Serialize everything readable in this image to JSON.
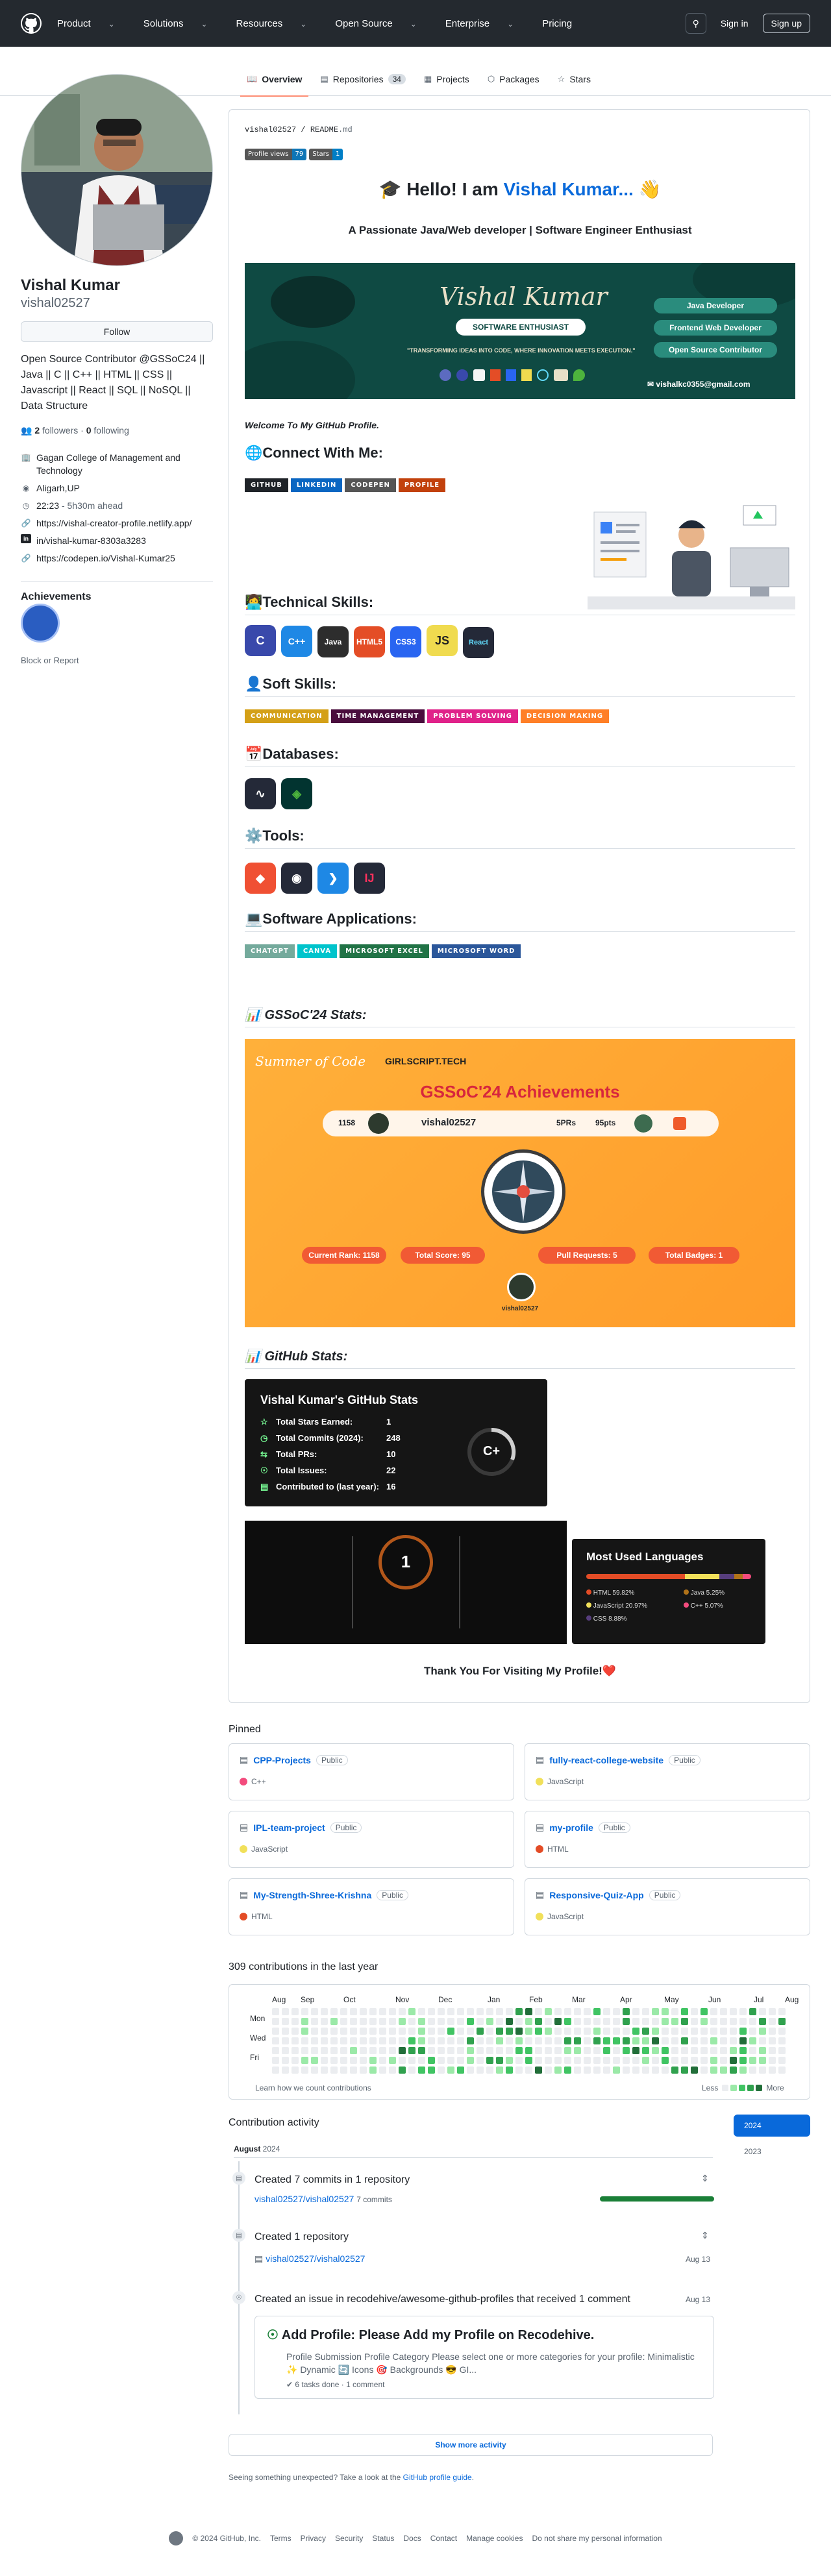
{
  "header": {
    "nav": [
      "Product",
      "Solutions",
      "Resources",
      "Open Source",
      "Enterprise",
      "Pricing"
    ],
    "signin": "Sign in",
    "signup": "Sign up"
  },
  "tabs": [
    {
      "label": "Overview",
      "icon": "book-icon"
    },
    {
      "label": "Repositories",
      "count": "34",
      "icon": "repo-icon"
    },
    {
      "label": "Projects",
      "icon": "table-icon"
    },
    {
      "label": "Packages",
      "icon": "package-icon"
    },
    {
      "label": "Stars",
      "icon": "star-icon"
    }
  ],
  "profile": {
    "name": "Vishal Kumar",
    "username": "vishal02527",
    "follow": "Follow",
    "bio": "Open Source Contributor @GSSoC24 || Java || C || C++ || HTML || CSS || Javascript || React || SQL || NoSQL || Data Structure",
    "followers": "2",
    "followers_label": "followers",
    "following": "0",
    "following_label": "following",
    "org": "Gagan College of Management and Technology",
    "location": "Aligarh,UP",
    "time": "22:23",
    "time_note": "- 5h30m ahead",
    "site": "https://vishal-creator-profile.netlify.app/",
    "linkedin": "in/vishal-kumar-8303a3283",
    "codepen": "https://codepen.io/Vishal-Kumar25",
    "achievements": "Achievements",
    "report": "Block or Report"
  },
  "readme": {
    "path_user": "vishal02527",
    "path_sep": " / ",
    "path_file": "README",
    "path_ext": ".md",
    "views_label": "Profile views",
    "views_value": "79",
    "stars_label": "Stars",
    "stars_value": "1",
    "hello": "Hello! I am ",
    "hello_name": "Vishal Kumar...",
    "subtitle": "A Passionate Java/Web developer | Software Engineer Enthusiast",
    "banner": {
      "name": "Vishal Kumar",
      "role": "SOFTWARE ENTHUSIAST",
      "tagline": "\"TRANSFORMING IDEAS INTO CODE, WHERE INNOVATION MEETS EXECUTION.\"",
      "pill1": "Java Developer",
      "pill2": "Frontend Web Developer",
      "pill3": "Open Source Contributor",
      "email": "vishalkc0355@gmail.com"
    },
    "welcome": "Welcome To My GitHub Profile.",
    "connect": "Connect With Me:",
    "connect_tags": [
      "GITHUB",
      "LINKEDIN",
      "CODEPEN",
      "PROFILE"
    ],
    "tech": "Technical Skills:",
    "tech_icons": [
      "C",
      "C++",
      "Java",
      "HTML5",
      "CSS3",
      "JS",
      "React"
    ],
    "soft": "Soft Skills:",
    "soft_tags": [
      "COMMUNICATION",
      "TIME MANAGEMENT",
      "PROBLEM SOLVING",
      "DECISION MAKING"
    ],
    "db": "Databases:",
    "tools": "Tools:",
    "apps": "Software Applications:",
    "app_tags": [
      "CHATGPT",
      "CANVA",
      "MICROSOFT EXCEL",
      "MICROSOFT WORD"
    ],
    "gssoc_h": "GSSoC'24 Stats:",
    "gssoc": {
      "brand1": "Summer of Code",
      "brand2": "GIRLSCRIPT.TECH",
      "title": "GSSoC'24 Achievements",
      "rank": "1158",
      "user": "vishal02527",
      "prs": "5PRs",
      "pts": "95pts",
      "s1": "Current Rank: 1158",
      "s2": "Total Score: 95",
      "s3": "Pull Requests: 5",
      "s4": "Total Badges: 1",
      "footer": "vishal02527"
    },
    "ghstats_h": "GitHub Stats:",
    "ghstats": {
      "title": "Vishal Kumar's GitHub Stats",
      "rows": [
        {
          "label": "Total Stars Earned:",
          "value": "1"
        },
        {
          "label": "Total Commits (2024):",
          "value": "248"
        },
        {
          "label": "Total PRs:",
          "value": "10"
        },
        {
          "label": "Total Issues:",
          "value": "22"
        },
        {
          "label": "Contributed to (last year):",
          "value": "16"
        }
      ],
      "grade": "C+"
    },
    "streak": "1",
    "langs": {
      "title": "Most Used Languages",
      "items": [
        {
          "name": "HTML 59.82%",
          "color": "#e34c26"
        },
        {
          "name": "Java 5.25%",
          "color": "#b07219"
        },
        {
          "name": "JavaScript 20.97%",
          "color": "#f1e05a"
        },
        {
          "name": "C++ 5.07%",
          "color": "#f34b7d"
        },
        {
          "name": "CSS 8.88%",
          "color": "#563d7c"
        }
      ]
    },
    "thanks": "Thank You For Visiting My Profile!"
  },
  "pinned": {
    "title": "Pinned",
    "items": [
      {
        "name": "CPP-Projects",
        "vis": "Public",
        "lang": "C++",
        "color": "#f34b7d"
      },
      {
        "name": "fully-react-college-website",
        "vis": "Public",
        "lang": "JavaScript",
        "color": "#f1e05a"
      },
      {
        "name": "IPL-team-project",
        "vis": "Public",
        "lang": "JavaScript",
        "color": "#f1e05a"
      },
      {
        "name": "my-profile",
        "vis": "Public",
        "lang": "HTML",
        "color": "#e34c26"
      },
      {
        "name": "My-Strength-Shree-Krishna",
        "vis": "Public",
        "lang": "HTML",
        "color": "#e34c26"
      },
      {
        "name": "Responsive-Quiz-App",
        "vis": "Public",
        "lang": "JavaScript",
        "color": "#f1e05a"
      }
    ]
  },
  "contrib": {
    "title": "309 contributions in the last year",
    "months": [
      "Aug",
      "Sep",
      "Oct",
      "Nov",
      "Dec",
      "Jan",
      "Feb",
      "Mar",
      "Apr",
      "May",
      "Jun",
      "Jul",
      "Aug"
    ],
    "days": [
      "Mon",
      "Wed",
      "Fri"
    ],
    "learn": "Learn how we count contributions",
    "less": "Less",
    "more": "More"
  },
  "activity": {
    "title": "Contribution activity",
    "month": "August",
    "year": "2024",
    "years": [
      "2024",
      "2023"
    ],
    "a1": "Created 7 commits in 1 repository",
    "a1_repo": "vishal02527/vishal02527",
    "a1_count": "7 commits",
    "a2": "Created 1 repository",
    "a2_repo": "vishal02527/vishal02527",
    "a2_date": "Aug 13",
    "a3": "Created an issue in recodehive/awesome-github-profiles that received 1 comment",
    "a3_date": "Aug 13",
    "issue_title": "Add Profile: Please Add my Profile on Recodehive.",
    "issue_body": "Profile Submission Profile Category Please select one or more categories for your profile: Minimalistic ✨ Dynamic 🔄 Icons 🎯 Backgrounds 😎 GI...",
    "issue_tasks": "6 tasks done",
    "issue_comments": "1 comment",
    "more": "Show more activity",
    "unexpected": "Seeing something unexpected? Take a look at the ",
    "guide": "GitHub profile guide",
    "guide_end": "."
  },
  "footer": {
    "copy": "© 2024 GitHub, Inc.",
    "links": [
      "Terms",
      "Privacy",
      "Security",
      "Status",
      "Docs",
      "Contact",
      "Manage cookies",
      "Do not share my personal information"
    ]
  }
}
